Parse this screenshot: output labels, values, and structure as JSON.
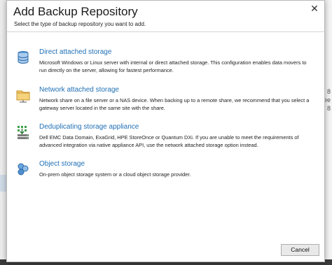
{
  "dialog": {
    "title": "Add Backup Repository",
    "subtitle": "Select the type of backup repository you want to add.",
    "close_glyph": "✕",
    "options": [
      {
        "title": "Direct attached storage",
        "description": "Microsoft Windows or Linux server with internal or direct attached storage. This configuration enables data movers to run directly on the server, allowing for fastest performance.",
        "icon": "database-icon"
      },
      {
        "title": "Network attached storage",
        "description": "Network share on a file server or a NAS device. When backing up to a remote share, we recommend that you select a gateway server located in the same site with the share.",
        "icon": "network-folder-icon"
      },
      {
        "title": "Deduplicating storage appliance",
        "description": "Dell EMC Data Domain, ExaGrid, HPE StoreOnce or Quantum DXi. If you are unable to meet the requirements of advanced integration via native appliance API, use the network attached storage option instead.",
        "icon": "dedup-appliance-icon"
      },
      {
        "title": "Object storage",
        "description": "On-prem object storage system or a cloud object storage provider.",
        "icon": "object-storage-icon"
      }
    ],
    "cancel_label": "Cancel"
  },
  "background": {
    "right_fragments": [
      "8",
      "ee",
      "8"
    ]
  },
  "colors": {
    "link_blue": "#1f6fb5",
    "icon_blue": "#3a7cc4",
    "folder_yellow": "#e8b54a",
    "dedup_green": "#3aa04a"
  }
}
